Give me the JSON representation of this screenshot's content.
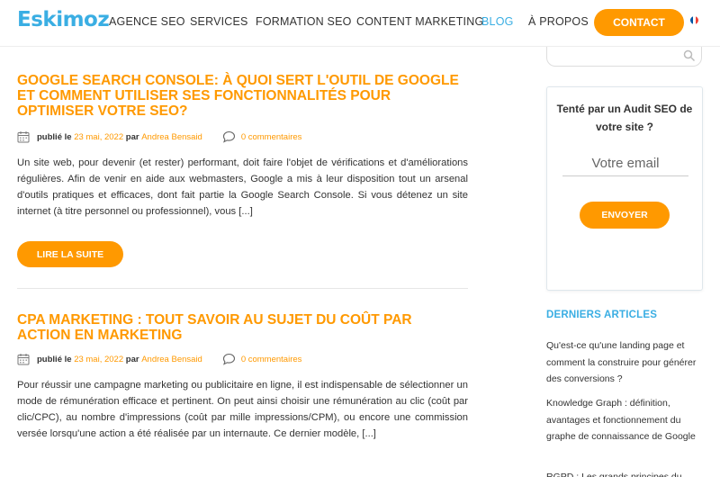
{
  "header": {
    "logo": "Eskimoz",
    "nav": [
      {
        "label": "AGENCE SEO"
      },
      {
        "label": "SERVICES"
      },
      {
        "label": "FORMATION SEO"
      },
      {
        "label": "CONTENT MARKETING"
      },
      {
        "label": "BLOG"
      },
      {
        "label": "À PROPOS"
      }
    ],
    "contact_label": "CONTACT",
    "flag": "france-flag"
  },
  "articles": [
    {
      "title": "GOOGLE SEARCH CONSOLE: À QUOI SERT L'OUTIL DE GOOGLE ET COMMENT UTILISER SES FONCTIONNALITÉS POUR OPTIMISER VOTRE SEO?",
      "published_prefix": "publié le",
      "date": "23 mai, 2022",
      "by": "par",
      "author": "Andrea Bensaid",
      "comments": "0 commentaires",
      "excerpt": "Un site web, pour devenir (et rester) performant, doit faire l'objet de vérifications et d'améliorations régulières. Afin de venir en aide aux webmasters, Google a mis à leur disposition tout un arsenal d'outils pratiques et efficaces, dont fait partie la Google Search Console. Si vous détenez un site internet (à titre personnel ou professionnel), vous [...]",
      "read_more": "LIRE LA SUITE"
    },
    {
      "title": "CPA MARKETING : TOUT SAVOIR AU SUJET DU COÛT PAR ACTION EN MARKETING",
      "published_prefix": "publié le",
      "date": "23 mai, 2022",
      "by": "par",
      "author": "Andrea Bensaid",
      "comments": "0 commentaires",
      "excerpt": "Pour réussir une campagne marketing ou publicitaire en ligne, il est indispensable de sélectionner un mode de rémunération efficace et pertinent. On peut ainsi choisir une rémunération au clic (coût par clic/CPC), au nombre d'impressions (coût par mille impressions/CPM), ou encore une commission versée lorsqu'une action a été réalisée par un internaute. Ce dernier modèle, [...]"
    }
  ],
  "sidebar": {
    "audit_title": "Tenté par un Audit SEO de votre site ?",
    "email_placeholder": "Votre email",
    "send_label": "ENVOYER",
    "recent_heading": "DERNIERS ARTICLES",
    "recent": [
      "Qu'est-ce qu'une landing page et comment la construire pour générer des conversions ?",
      "Knowledge Graph : définition, avantages et fonctionnement du graphe de connaissance de Google",
      "RGPD : Les grands principes du"
    ]
  },
  "colors": {
    "accent": "#ff9900",
    "brand_blue": "#3aaee3"
  }
}
